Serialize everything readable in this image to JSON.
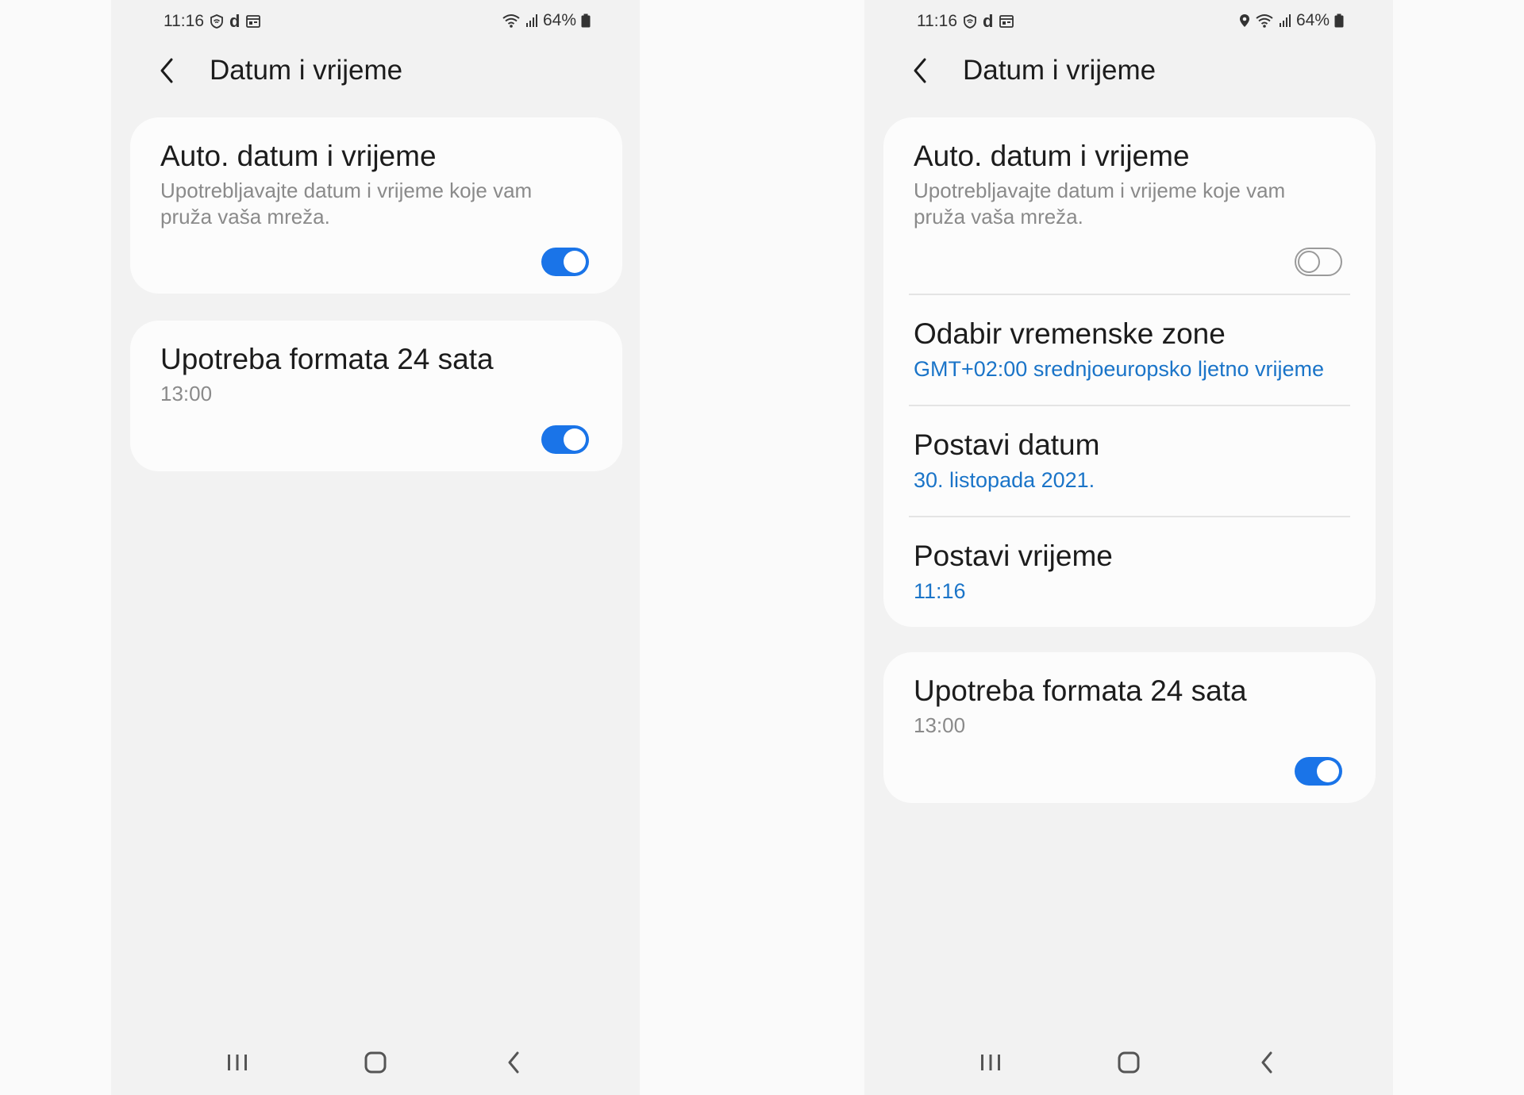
{
  "colors": {
    "accent": "#1a74e8",
    "link": "#1a74c8",
    "secondary_text": "#8a8a8a",
    "screen_bg": "#f2f2f2",
    "card_bg": "#fcfcfc"
  },
  "left": {
    "status": {
      "time": "11:16",
      "carrier_glyph": "d",
      "battery": "64%"
    },
    "title": "Datum i vrijeme",
    "auto": {
      "title": "Auto. datum i vrijeme",
      "desc": "Upotrebljavajte datum i vrijeme koje vam pruža vaša mreža.",
      "toggle": "on"
    },
    "format24": {
      "title": "Upotreba formata 24 sata",
      "example": "13:00",
      "toggle": "on"
    }
  },
  "right": {
    "status": {
      "time": "11:16",
      "carrier_glyph": "d",
      "battery": "64%"
    },
    "title": "Datum i vrijeme",
    "auto": {
      "title": "Auto. datum i vrijeme",
      "desc": "Upotrebljavajte datum i vrijeme koje vam pruža vaša mreža.",
      "toggle": "off"
    },
    "timezone": {
      "title": "Odabir vremenske zone",
      "value": "GMT+02:00 srednjoeuropsko ljetno vrijeme"
    },
    "set_date": {
      "title": "Postavi datum",
      "value": "30. listopada 2021."
    },
    "set_time": {
      "title": "Postavi vrijeme",
      "value": "11:16"
    },
    "format24": {
      "title": "Upotreba formata 24 sata",
      "example": "13:00",
      "toggle": "on"
    }
  },
  "icons": {
    "status_left": [
      "shield-wifi-icon",
      "d-app-icon",
      "calendar-icon"
    ],
    "status_right_left_phone": [
      "wifi-icon",
      "signal-icon",
      "battery-icon"
    ],
    "status_right_right_phone": [
      "location-icon",
      "wifi-icon",
      "signal-icon",
      "battery-icon"
    ],
    "nav": [
      "recents-icon",
      "home-icon",
      "back-icon"
    ]
  }
}
